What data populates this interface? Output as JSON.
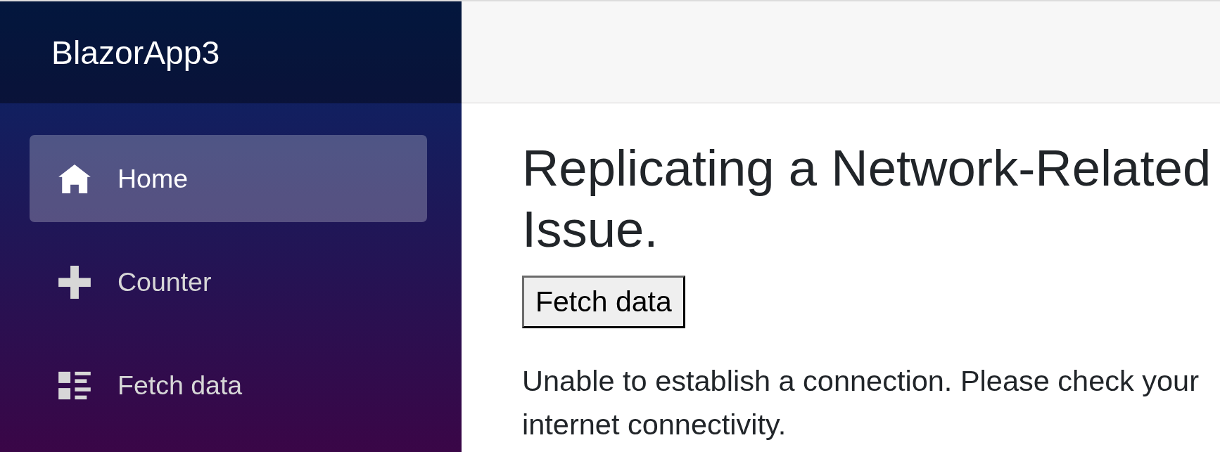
{
  "sidebar": {
    "brand": "BlazorApp3",
    "nav_items": [
      {
        "label": "Home",
        "kind": "home",
        "selected": true
      },
      {
        "label": "Counter",
        "kind": "plus",
        "selected": false
      },
      {
        "label": "Fetch data",
        "kind": "list",
        "selected": false
      }
    ]
  },
  "content": {
    "heading": "Replicating a Network-Related Issue.",
    "button": "Fetch data",
    "message": "Unable to establish a connection. Please check your internet connectivity."
  }
}
